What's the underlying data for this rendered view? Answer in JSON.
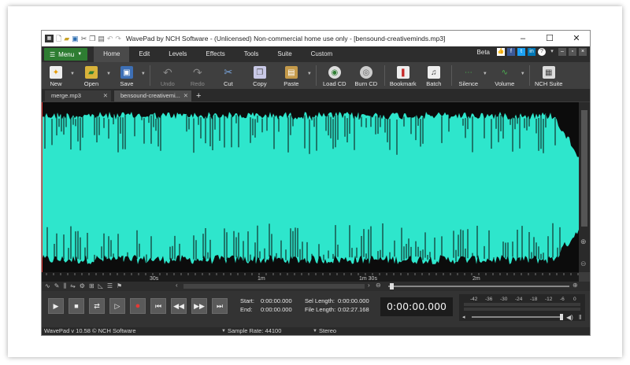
{
  "window": {
    "title": "WavePad by NCH Software - (Unlicensed) Non-commercial home use only - [bensound-creativeminds.mp3]",
    "controls": [
      "–",
      "☐",
      "✕"
    ]
  },
  "menu_tabs": {
    "menu_label": "Menu",
    "items": [
      "Home",
      "Edit",
      "Levels",
      "Effects",
      "Tools",
      "Suite",
      "Custom"
    ],
    "active": "Home",
    "beta_label": "Beta"
  },
  "toolbar": {
    "new": "New",
    "open": "Open",
    "save": "Save",
    "undo": "Undo",
    "redo": "Redo",
    "cut": "Cut",
    "copy": "Copy",
    "paste": "Paste",
    "load_cd": "Load CD",
    "burn_cd": "Burn CD",
    "bookmark": "Bookmark",
    "batch": "Batch",
    "silence": "Silence",
    "volume": "Volume",
    "nch_suite": "NCH Suite"
  },
  "file_tabs": [
    {
      "label": "merge.mp3",
      "active": false
    },
    {
      "label": "bensound-creativemi...",
      "active": true
    }
  ],
  "ruler": {
    "ticks": [
      "30s",
      "1m",
      "1m 30s",
      "2m"
    ]
  },
  "transport": {
    "start_label": "Start:",
    "start_value": "0:00:00.000",
    "end_label": "End:",
    "end_value": "0:00:00.000",
    "sel_length_label": "Sel Length:",
    "sel_length_value": "0:00:00.000",
    "file_length_label": "File Length:",
    "file_length_value": "0:02:27.168",
    "current_time": "0:00:00.000",
    "meter_ticks": [
      "-42",
      "-36",
      "-30",
      "-24",
      "-18",
      "-12",
      "-6",
      "0"
    ]
  },
  "status": {
    "version": "WavePad v 10.58 © NCH Software",
    "sample_rate": "Sample Rate: 44100",
    "channels": "Stereo"
  },
  "colors": {
    "waveform": "#2ee6cc",
    "menu_green": "#2e7d32",
    "record_red": "#e53935"
  }
}
